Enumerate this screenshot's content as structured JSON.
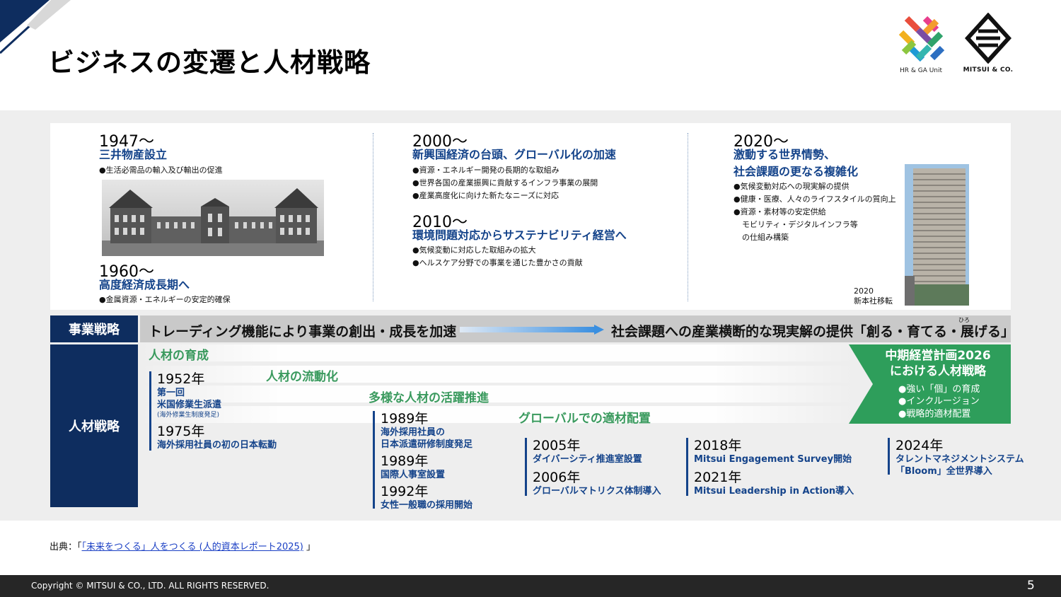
{
  "header": {
    "title": "ビジネスの変遷と人材戦略",
    "hr_logo_text": "HR & GA Unit",
    "mitsui_logo_text": "MITSUI & CO."
  },
  "eras": {
    "e1947": {
      "year": "1947〜",
      "title": "三井物産設立",
      "bullets": [
        "●生活必需品の輸入及び輸出の促進"
      ]
    },
    "e1960": {
      "year": "1960〜",
      "title": "高度経済成長期へ",
      "bullets": [
        "●金属資源・エネルギーの安定的確保"
      ]
    },
    "e2000": {
      "year": "2000〜",
      "title": "新興国経済の台頭、グローバル化の加速",
      "bullets": [
        "●資源・エネルギー開発の長期的な取組み",
        "●世界各国の産業振興に貢献するインフラ事業の展開",
        "●産業高度化に向けた新たなニーズに対応"
      ]
    },
    "e2010": {
      "year": "2010〜",
      "title": "環境問題対応からサステナビリティ経営へ",
      "bullets": [
        "●気候変動に対応した取組みの拡大",
        "●ヘルスケア分野での事業を通じた豊かさの貢献"
      ]
    },
    "e2020": {
      "year": "2020〜",
      "title_line1": "激動する世界情勢、",
      "title_line2": "社会課題の更なる複雑化",
      "bullets": [
        "●気候変動対応への現実解の提供",
        "●健康・医療、人々のライフスタイルの質向上",
        "●資源・素材等の安定供給",
        "モビリティ・デジタルインフラ等",
        "の仕組み構築"
      ],
      "caption_line1": "2020",
      "caption_line2": "新本社移転"
    }
  },
  "business_strategy": {
    "label": "事業戦略",
    "left_text": "トレーディング機能により事業の創出・成長を加速",
    "right_text": "社会課題への産業横断的な現実解の提供「創る・育てる・展げる」",
    "ruby": "ひろ"
  },
  "hr_strategy": {
    "label": "人材戦略",
    "phases": [
      "人材の育成",
      "人材の流動化",
      "多様な人材の活躍推進",
      "グローバルでの適材配置"
    ],
    "plan": {
      "title_line1": "中期経営計画2026",
      "title_line2": "における人材戦略",
      "items": [
        "●強い「個」の育成",
        "●インクルージョン",
        "●戦略的適材配置"
      ]
    },
    "events": {
      "g1": {
        "y1": "1952年",
        "t1a": "第一回",
        "t1b": "米国修業生派遣",
        "t1c": "(海外修業生制度発足)",
        "y2": "1975年",
        "t2": "海外採用社員の初の日本転勤"
      },
      "g2": {
        "y1": "1989年",
        "t1a": "海外採用社員の",
        "t1b": "日本派遣研修制度発足",
        "y2": "1989年",
        "t2": "国際人事室設置",
        "y3": "1992年",
        "t3": "女性一般職の採用開始"
      },
      "g3": {
        "y1": "2005年",
        "t1": "ダイバーシティ推進室設置",
        "y2": "2006年",
        "t2": "グローバルマトリクス体制導入"
      },
      "g4": {
        "y1": "2018年",
        "t1": "Mitsui Engagement Survey開始",
        "y2": "2021年",
        "t2": "Mitsui Leadership in Action導入"
      },
      "g5": {
        "y1": "2024年",
        "t1a": "タレントマネジメントシステム",
        "t1b": "「Bloom」全世界導入"
      }
    }
  },
  "source": {
    "prefix": "出典：「",
    "link": "「未来をつくる」人をつくる (人的資本レポート2025)",
    "suffix": " 」"
  },
  "footer": {
    "copyright": "Copyright © MITSUI & CO., LTD. ALL RIGHTS RESERVED.",
    "page_number": "5"
  },
  "colors": {
    "navy": "#0e2d5f",
    "title_blue": "#14438a",
    "green": "#2e9e5b",
    "footer": "#262626"
  }
}
